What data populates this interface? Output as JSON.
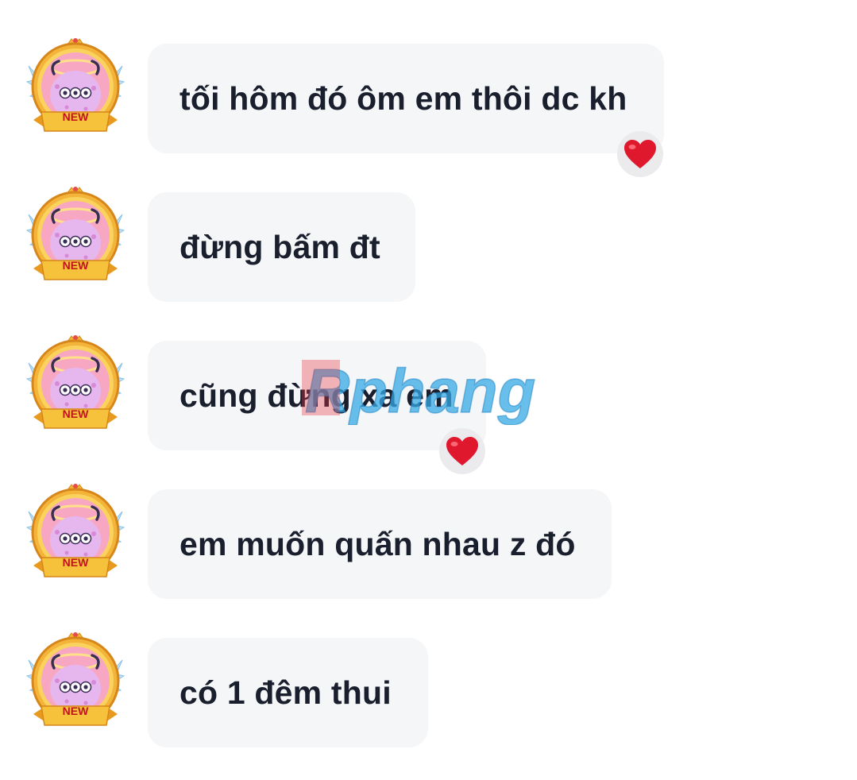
{
  "messages": [
    {
      "text": "tối hôm đó ôm em thôi dc kh",
      "reaction": "heart"
    },
    {
      "text": "đừng bấm đt",
      "reaction": null
    },
    {
      "text": "cũng đừng xa em",
      "reaction": "heart"
    },
    {
      "text": "em muốn quấn nhau z đó",
      "reaction": null
    },
    {
      "text": "có 1 đêm thui",
      "reaction": null
    }
  ],
  "avatar_badge": "NEW",
  "watermark": "Rphang",
  "colors": {
    "bubble": "#f5f6f8",
    "text": "#1a1f2e",
    "reaction_bg": "#ebebee",
    "heart": "#e0182d"
  }
}
